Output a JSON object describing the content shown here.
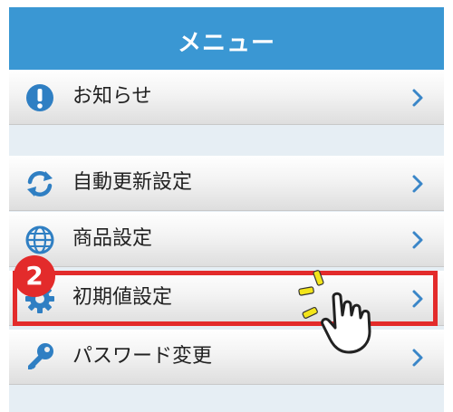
{
  "header": {
    "title": "メニュー"
  },
  "menu": {
    "items": [
      {
        "label": "お知らせ",
        "icon": "info-icon"
      },
      {
        "label": "自動更新設定",
        "icon": "refresh-icon"
      },
      {
        "label": "商品設定",
        "icon": "globe-icon"
      },
      {
        "label": "初期値設定",
        "icon": "gear-icon"
      },
      {
        "label": "パスワード変更",
        "icon": "key-icon"
      }
    ]
  },
  "annotation": {
    "step_number": "2",
    "highlight_color": "#e32b2b"
  },
  "colors": {
    "header": "#3a97d3",
    "icon": "#3a86c8",
    "chevron": "#3a86c8"
  }
}
